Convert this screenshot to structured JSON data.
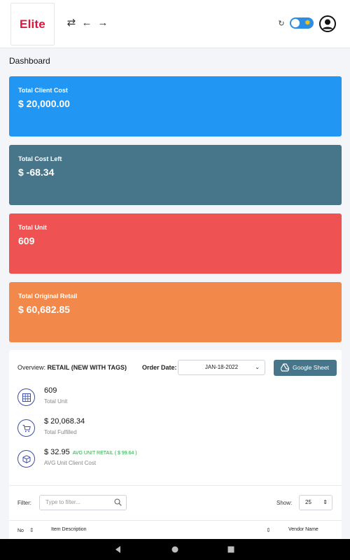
{
  "header": {
    "logo_text": "Elite",
    "icons": [
      "swap-icon",
      "back-arrow-icon",
      "forward-arrow-icon",
      "refresh-icon",
      "theme-toggle",
      "user-avatar-icon"
    ]
  },
  "page_title": "Dashboard",
  "cards": [
    {
      "label": "Total Client Cost",
      "value": "$ 20,000.00",
      "color": "#2196f3"
    },
    {
      "label": "Total Cost Left",
      "value": "$ -68.34",
      "color": "#47768a"
    },
    {
      "label": "Total Unit",
      "value": "609",
      "color": "#ee5252"
    },
    {
      "label": "Total Original Retail",
      "value": "$ 60,682.85",
      "color": "#f2884a"
    }
  ],
  "overview": {
    "prefix": "Overview:",
    "title": "RETAIL (NEW WITH TAGS)",
    "order_date_label": "Order Date:",
    "order_date_value": "JAN-18-2022",
    "google_sheet_label": "Google Sheet"
  },
  "stats": [
    {
      "value": "609",
      "label": "Total Unit",
      "icon": "grid-icon"
    },
    {
      "value": "$ 20,068.34",
      "label": "Total Fulfilled",
      "icon": "cart-icon"
    },
    {
      "value": "$ 32.95",
      "extra": "AVG UNIT RETAIL ( $ 99.64 )",
      "label": "AVG Unit Client Cost",
      "icon": "box-icon"
    }
  ],
  "table": {
    "filter_label": "Filter:",
    "filter_placeholder": "Type to filter...",
    "show_label": "Show:",
    "show_value": "25",
    "columns": [
      "No",
      "Item Description",
      "Vendor Name"
    ]
  },
  "colors": {
    "brand": "#e0143c",
    "accent": "#47768a",
    "stat_icon": "#3a4fa8",
    "avg_retail": "#27a845"
  }
}
